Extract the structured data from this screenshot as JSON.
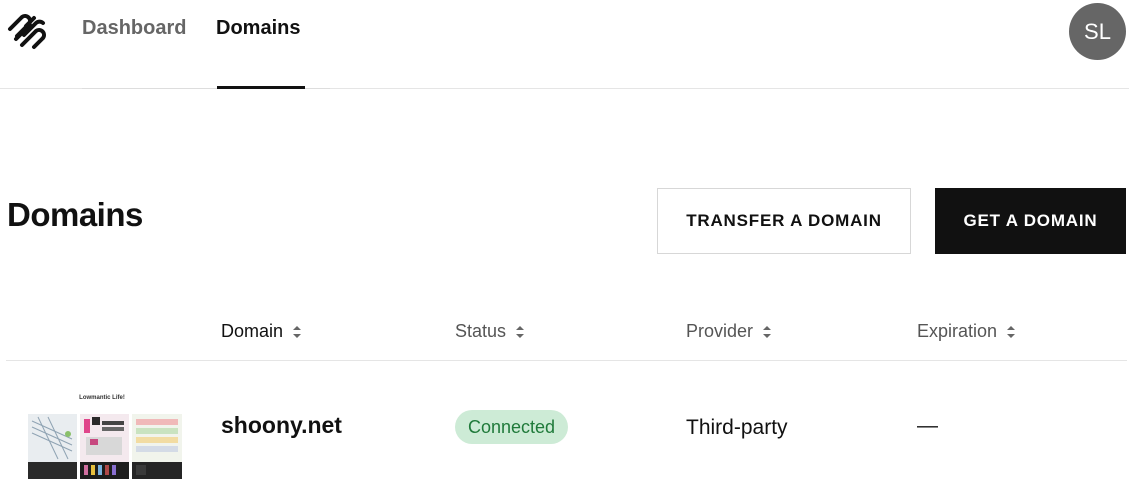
{
  "nav": {
    "tabs": [
      {
        "label": "Dashboard",
        "active": false
      },
      {
        "label": "Domains",
        "active": true
      }
    ],
    "avatar_initials": "SL",
    "logo_icon": "squarespace-logo-icon"
  },
  "header": {
    "title": "Domains",
    "transfer_button": "TRANSFER A DOMAIN",
    "get_button": "GET A DOMAIN"
  },
  "table": {
    "columns": [
      "Domain",
      "Status",
      "Provider",
      "Expiration"
    ],
    "sort_icon": "sort-updown-icon",
    "rows": [
      {
        "thumbnail_title": "Lowmantic Life!",
        "domain": "shoony.net",
        "status": "Connected",
        "provider": "Third-party",
        "expiration": "—"
      }
    ]
  },
  "colors": {
    "accent_dark": "#111111",
    "status_connected_bg": "#cdebd6",
    "status_connected_text": "#1f7a3a",
    "avatar_bg": "#666666"
  }
}
